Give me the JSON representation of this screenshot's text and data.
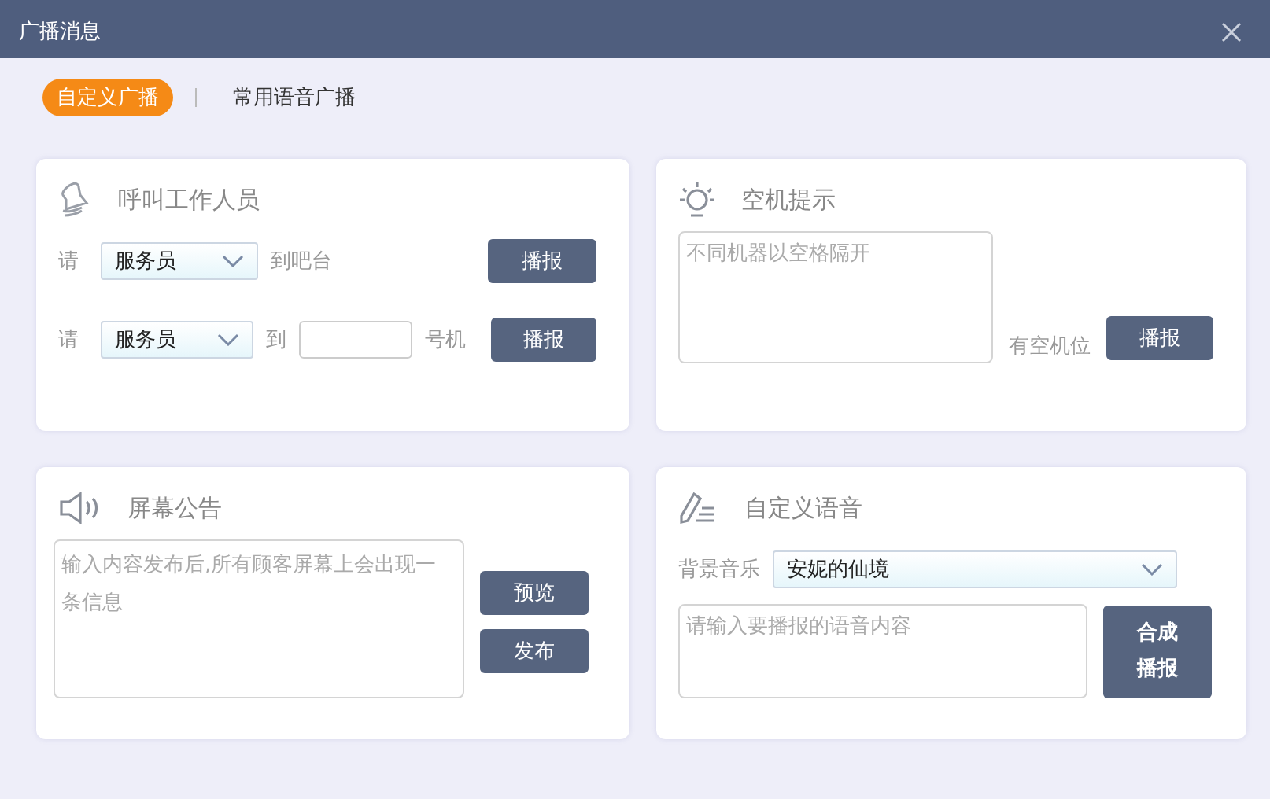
{
  "window": {
    "title": "广播消息"
  },
  "tabs": [
    {
      "label": "自定义广播",
      "selected": true
    },
    {
      "label": "常用语音广播",
      "selected": false
    }
  ],
  "call_staff": {
    "title": "呼叫工作人员",
    "rows": [
      {
        "kind": "destination",
        "prefix": "请",
        "select": "服务员",
        "text": "到吧台",
        "button": "播报"
      },
      {
        "kind": "machine",
        "prefix": "请",
        "select": "服务员",
        "text": "到",
        "suffix": "号机",
        "button": "播报"
      }
    ]
  },
  "idle_machine": {
    "title": "空机提示",
    "placeholder": "不同机器以空格隔开",
    "label": "有空机位",
    "button": "播报"
  },
  "announcement": {
    "title": "屏幕公告",
    "placeholder": "输入内容发布后,所有顾客屏幕上会出现一条信息",
    "buttons": [
      "预览",
      "发布"
    ]
  },
  "custom_voice": {
    "title": "自定义语音",
    "music_label": "背景音乐",
    "music": "安妮的仙境",
    "placeholder": "请输入要播报的语音内容",
    "button_lines": [
      "合成",
      "播报"
    ]
  }
}
